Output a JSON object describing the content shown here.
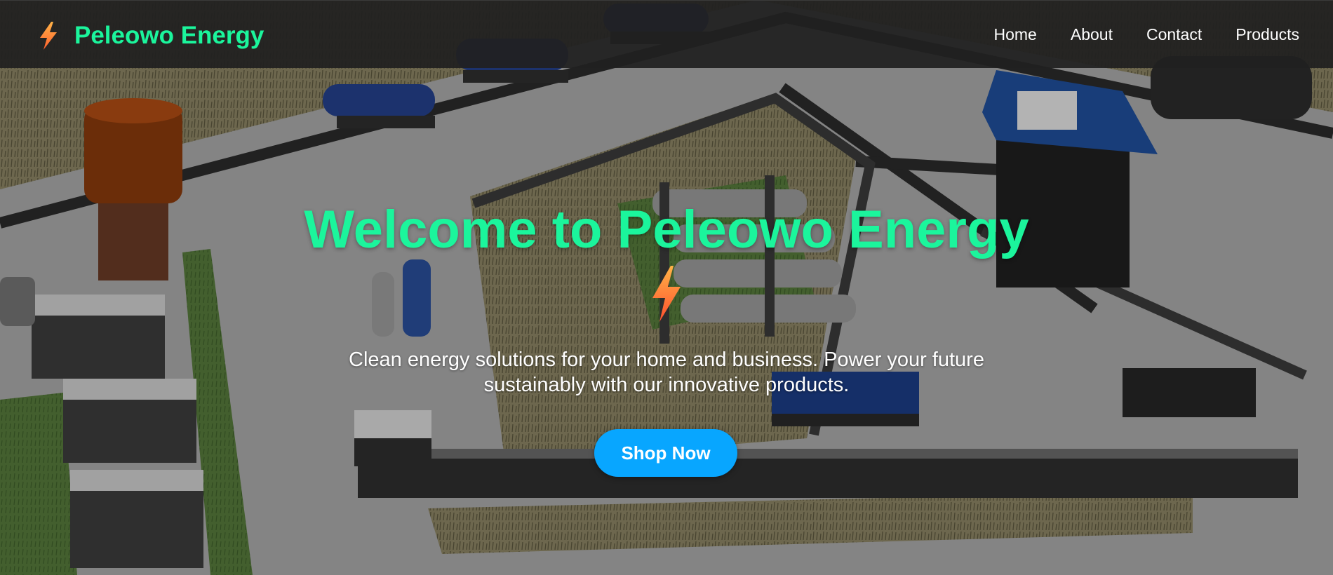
{
  "brand": {
    "name": "Peleowo Energy",
    "icon": "lightning-bolt-icon",
    "color": "#1bf59c",
    "icon_colors": [
      "#ffb347",
      "#ff5f2e"
    ]
  },
  "nav": {
    "items": [
      {
        "label": "Home"
      },
      {
        "label": "About"
      },
      {
        "label": "Contact"
      },
      {
        "label": "Products"
      }
    ]
  },
  "hero": {
    "background": "industrial-energy-facility-3d-render",
    "title": "Welcome to Peleowo Energy",
    "icon": "lightning-bolt-icon",
    "description": "Clean energy solutions for your home and business. Power your future sustainably with our innovative products.",
    "cta_label": "Shop Now",
    "cta_color": "#08a6ff"
  }
}
